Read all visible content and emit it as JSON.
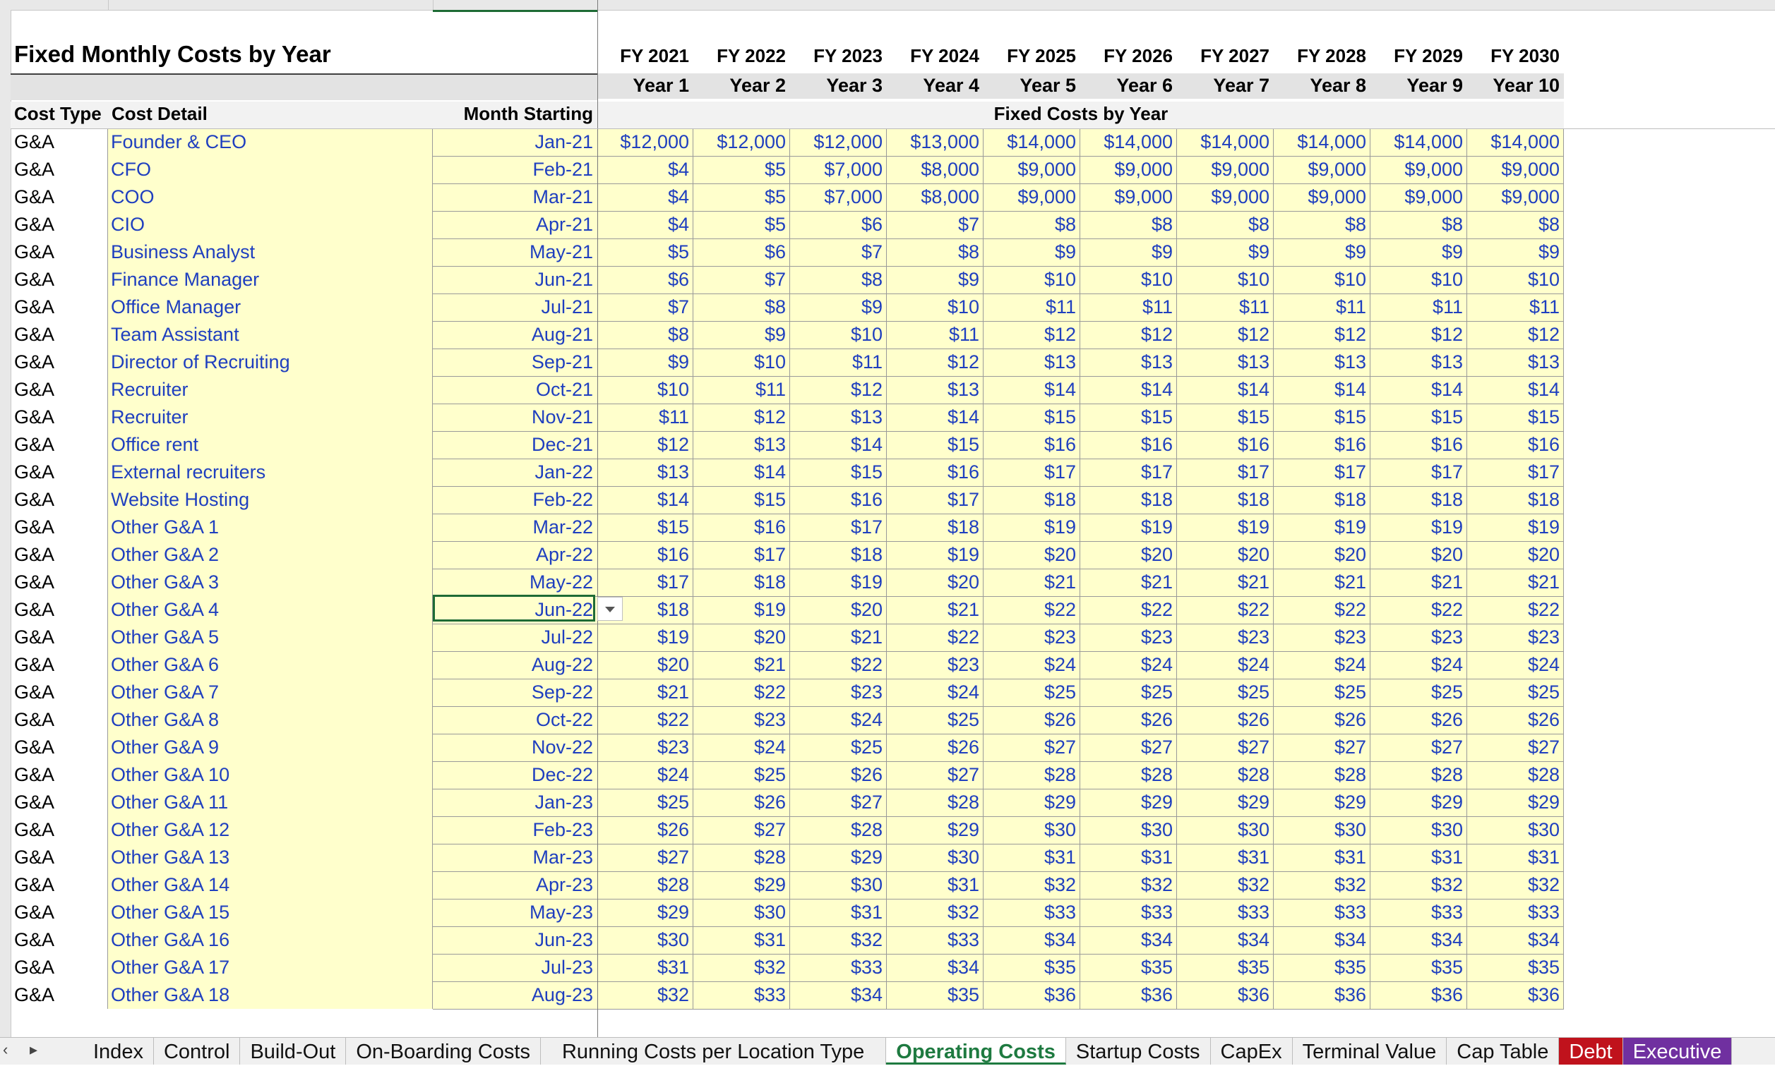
{
  "sheet": {
    "title": "Fixed Monthly Costs by Year",
    "fy_headers": [
      "FY 2021",
      "FY 2022",
      "FY 2023",
      "FY 2024",
      "FY 2025",
      "FY 2026",
      "FY 2027",
      "FY 2028",
      "FY 2029",
      "FY 2030"
    ],
    "year_headers": [
      "Year 1",
      "Year 2",
      "Year 3",
      "Year 4",
      "Year 5",
      "Year 6",
      "Year 7",
      "Year 8",
      "Year 9",
      "Year 10"
    ],
    "col_labels": {
      "cost_type": "Cost Type",
      "cost_detail": "Cost Detail",
      "month_starting": "Month Starting",
      "fixed_costs": "Fixed Costs by Year"
    },
    "rows": [
      {
        "type": "G&A",
        "detail": "Founder & CEO",
        "month": "Jan-21",
        "values": [
          "$12,000",
          "$12,000",
          "$12,000",
          "$13,000",
          "$14,000",
          "$14,000",
          "$14,000",
          "$14,000",
          "$14,000",
          "$14,000"
        ]
      },
      {
        "type": "G&A",
        "detail": "CFO",
        "month": "Feb-21",
        "values": [
          "$4",
          "$5",
          "$7,000",
          "$8,000",
          "$9,000",
          "$9,000",
          "$9,000",
          "$9,000",
          "$9,000",
          "$9,000"
        ]
      },
      {
        "type": "G&A",
        "detail": "COO",
        "month": "Mar-21",
        "values": [
          "$4",
          "$5",
          "$7,000",
          "$8,000",
          "$9,000",
          "$9,000",
          "$9,000",
          "$9,000",
          "$9,000",
          "$9,000"
        ]
      },
      {
        "type": "G&A",
        "detail": "CIO",
        "month": "Apr-21",
        "values": [
          "$4",
          "$5",
          "$6",
          "$7",
          "$8",
          "$8",
          "$8",
          "$8",
          "$8",
          "$8"
        ]
      },
      {
        "type": "G&A",
        "detail": "Business Analyst",
        "month": "May-21",
        "values": [
          "$5",
          "$6",
          "$7",
          "$8",
          "$9",
          "$9",
          "$9",
          "$9",
          "$9",
          "$9"
        ]
      },
      {
        "type": "G&A",
        "detail": "Finance Manager",
        "month": "Jun-21",
        "values": [
          "$6",
          "$7",
          "$8",
          "$9",
          "$10",
          "$10",
          "$10",
          "$10",
          "$10",
          "$10"
        ]
      },
      {
        "type": "G&A",
        "detail": "Office Manager",
        "month": "Jul-21",
        "values": [
          "$7",
          "$8",
          "$9",
          "$10",
          "$11",
          "$11",
          "$11",
          "$11",
          "$11",
          "$11"
        ]
      },
      {
        "type": "G&A",
        "detail": "Team Assistant",
        "month": "Aug-21",
        "values": [
          "$8",
          "$9",
          "$10",
          "$11",
          "$12",
          "$12",
          "$12",
          "$12",
          "$12",
          "$12"
        ]
      },
      {
        "type": "G&A",
        "detail": "Director of Recruiting",
        "month": "Sep-21",
        "values": [
          "$9",
          "$10",
          "$11",
          "$12",
          "$13",
          "$13",
          "$13",
          "$13",
          "$13",
          "$13"
        ]
      },
      {
        "type": "G&A",
        "detail": "Recruiter",
        "month": "Oct-21",
        "values": [
          "$10",
          "$11",
          "$12",
          "$13",
          "$14",
          "$14",
          "$14",
          "$14",
          "$14",
          "$14"
        ]
      },
      {
        "type": "G&A",
        "detail": "Recruiter",
        "month": "Nov-21",
        "values": [
          "$11",
          "$12",
          "$13",
          "$14",
          "$15",
          "$15",
          "$15",
          "$15",
          "$15",
          "$15"
        ]
      },
      {
        "type": "G&A",
        "detail": "Office rent",
        "month": "Dec-21",
        "values": [
          "$12",
          "$13",
          "$14",
          "$15",
          "$16",
          "$16",
          "$16",
          "$16",
          "$16",
          "$16"
        ]
      },
      {
        "type": "G&A",
        "detail": "External recruiters",
        "month": "Jan-22",
        "values": [
          "$13",
          "$14",
          "$15",
          "$16",
          "$17",
          "$17",
          "$17",
          "$17",
          "$17",
          "$17"
        ]
      },
      {
        "type": "G&A",
        "detail": "Website Hosting",
        "month": "Feb-22",
        "values": [
          "$14",
          "$15",
          "$16",
          "$17",
          "$18",
          "$18",
          "$18",
          "$18",
          "$18",
          "$18"
        ]
      },
      {
        "type": "G&A",
        "detail": "Other G&A 1",
        "month": "Mar-22",
        "values": [
          "$15",
          "$16",
          "$17",
          "$18",
          "$19",
          "$19",
          "$19",
          "$19",
          "$19",
          "$19"
        ]
      },
      {
        "type": "G&A",
        "detail": "Other G&A 2",
        "month": "Apr-22",
        "values": [
          "$16",
          "$17",
          "$18",
          "$19",
          "$20",
          "$20",
          "$20",
          "$20",
          "$20",
          "$20"
        ]
      },
      {
        "type": "G&A",
        "detail": "Other G&A 3",
        "month": "May-22",
        "values": [
          "$17",
          "$18",
          "$19",
          "$20",
          "$21",
          "$21",
          "$21",
          "$21",
          "$21",
          "$21"
        ]
      },
      {
        "type": "G&A",
        "detail": "Other G&A 4",
        "month": "Jun-22",
        "values": [
          "$18",
          "$19",
          "$20",
          "$21",
          "$22",
          "$22",
          "$22",
          "$22",
          "$22",
          "$22"
        ]
      },
      {
        "type": "G&A",
        "detail": "Other G&A 5",
        "month": "Jul-22",
        "values": [
          "$19",
          "$20",
          "$21",
          "$22",
          "$23",
          "$23",
          "$23",
          "$23",
          "$23",
          "$23"
        ]
      },
      {
        "type": "G&A",
        "detail": "Other G&A 6",
        "month": "Aug-22",
        "values": [
          "$20",
          "$21",
          "$22",
          "$23",
          "$24",
          "$24",
          "$24",
          "$24",
          "$24",
          "$24"
        ]
      },
      {
        "type": "G&A",
        "detail": "Other G&A 7",
        "month": "Sep-22",
        "values": [
          "$21",
          "$22",
          "$23",
          "$24",
          "$25",
          "$25",
          "$25",
          "$25",
          "$25",
          "$25"
        ]
      },
      {
        "type": "G&A",
        "detail": "Other G&A 8",
        "month": "Oct-22",
        "values": [
          "$22",
          "$23",
          "$24",
          "$25",
          "$26",
          "$26",
          "$26",
          "$26",
          "$26",
          "$26"
        ]
      },
      {
        "type": "G&A",
        "detail": "Other G&A 9",
        "month": "Nov-22",
        "values": [
          "$23",
          "$24",
          "$25",
          "$26",
          "$27",
          "$27",
          "$27",
          "$27",
          "$27",
          "$27"
        ]
      },
      {
        "type": "G&A",
        "detail": "Other G&A 10",
        "month": "Dec-22",
        "values": [
          "$24",
          "$25",
          "$26",
          "$27",
          "$28",
          "$28",
          "$28",
          "$28",
          "$28",
          "$28"
        ]
      },
      {
        "type": "G&A",
        "detail": "Other G&A 11",
        "month": "Jan-23",
        "values": [
          "$25",
          "$26",
          "$27",
          "$28",
          "$29",
          "$29",
          "$29",
          "$29",
          "$29",
          "$29"
        ]
      },
      {
        "type": "G&A",
        "detail": "Other G&A 12",
        "month": "Feb-23",
        "values": [
          "$26",
          "$27",
          "$28",
          "$29",
          "$30",
          "$30",
          "$30",
          "$30",
          "$30",
          "$30"
        ]
      },
      {
        "type": "G&A",
        "detail": "Other G&A 13",
        "month": "Mar-23",
        "values": [
          "$27",
          "$28",
          "$29",
          "$30",
          "$31",
          "$31",
          "$31",
          "$31",
          "$31",
          "$31"
        ]
      },
      {
        "type": "G&A",
        "detail": "Other G&A 14",
        "month": "Apr-23",
        "values": [
          "$28",
          "$29",
          "$30",
          "$31",
          "$32",
          "$32",
          "$32",
          "$32",
          "$32",
          "$32"
        ]
      },
      {
        "type": "G&A",
        "detail": "Other G&A 15",
        "month": "May-23",
        "values": [
          "$29",
          "$30",
          "$31",
          "$32",
          "$33",
          "$33",
          "$33",
          "$33",
          "$33",
          "$33"
        ]
      },
      {
        "type": "G&A",
        "detail": "Other G&A 16",
        "month": "Jun-23",
        "values": [
          "$30",
          "$31",
          "$32",
          "$33",
          "$34",
          "$34",
          "$34",
          "$34",
          "$34",
          "$34"
        ]
      },
      {
        "type": "G&A",
        "detail": "Other G&A 17",
        "month": "Jul-23",
        "values": [
          "$31",
          "$32",
          "$33",
          "$34",
          "$35",
          "$35",
          "$35",
          "$35",
          "$35",
          "$35"
        ]
      },
      {
        "type": "G&A",
        "detail": "Other G&A 18",
        "month": "Aug-23",
        "values": [
          "$32",
          "$33",
          "$34",
          "$35",
          "$36",
          "$36",
          "$36",
          "$36",
          "$36",
          "$36"
        ]
      }
    ]
  },
  "tabs": [
    {
      "label": "Index",
      "state": "normal"
    },
    {
      "label": "Control",
      "state": "normal"
    },
    {
      "label": "Build-Out",
      "state": "normal"
    },
    {
      "label": "On-Boarding Costs",
      "state": "normal"
    },
    {
      "label": "Running Costs per Location Type",
      "state": "normal"
    },
    {
      "label": "Operating Costs",
      "state": "active"
    },
    {
      "label": "Startup Costs",
      "state": "normal"
    },
    {
      "label": "CapEx",
      "state": "normal"
    },
    {
      "label": "Terminal Value",
      "state": "normal"
    },
    {
      "label": "Cap Table",
      "state": "normal"
    },
    {
      "label": "Debt",
      "state": "debt"
    },
    {
      "label": "Executive",
      "state": "exec"
    }
  ],
  "colors": {
    "input_blue": "#1f3fbf",
    "input_yellow": "#ffffcc",
    "active_tab": "#1e7a40",
    "debt_tab": "#c0121c",
    "exec_tab": "#7030a0"
  },
  "icons": {
    "tab_nav": "chevron-right-icon",
    "dropdown": "dropdown-arrow-icon"
  }
}
